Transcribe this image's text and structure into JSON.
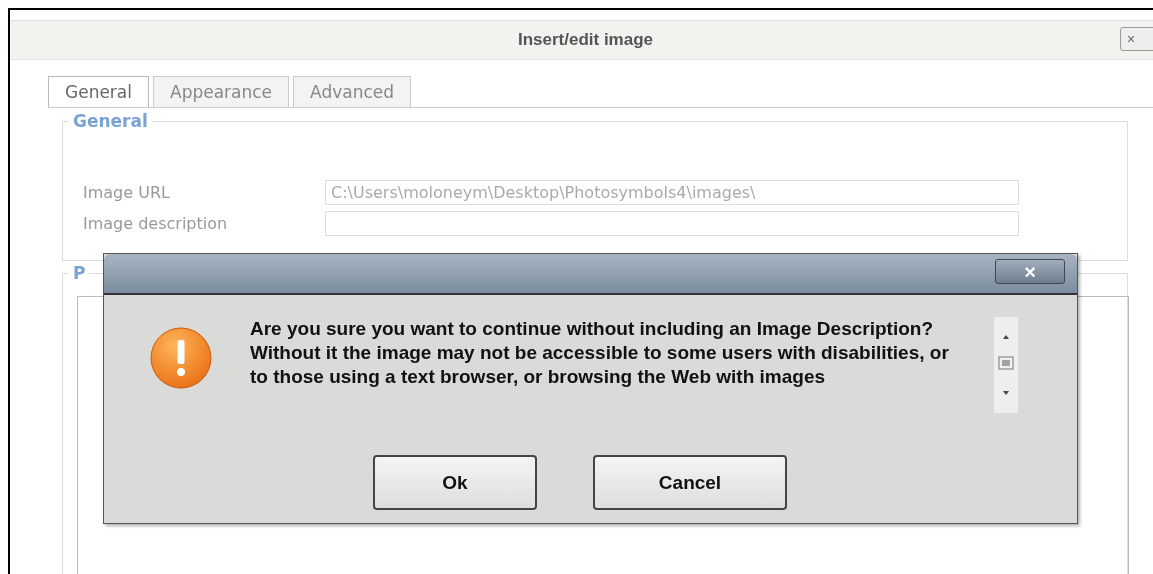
{
  "window": {
    "title": "Insert/edit image",
    "close": "×"
  },
  "tabs": [
    {
      "label": "General",
      "selected": true
    },
    {
      "label": "Appearance",
      "selected": false
    },
    {
      "label": "Advanced",
      "selected": false
    }
  ],
  "general": {
    "legend": "General",
    "fields": [
      {
        "label": "Image URL",
        "value": "C:\\Users\\moloneym\\Desktop\\Photosymbols4\\images\\"
      },
      {
        "label": "Image description"
      }
    ]
  },
  "section_2": {
    "legend": "P"
  },
  "dialog": {
    "close": "×",
    "message": "Are you sure you want to continue without including an Image Description? Without it the image may not be accessible to some users with disabilities, or to those using a text browser, or browsing the Web with images",
    "buttons": [
      "Ok",
      "Cancel"
    ]
  }
}
